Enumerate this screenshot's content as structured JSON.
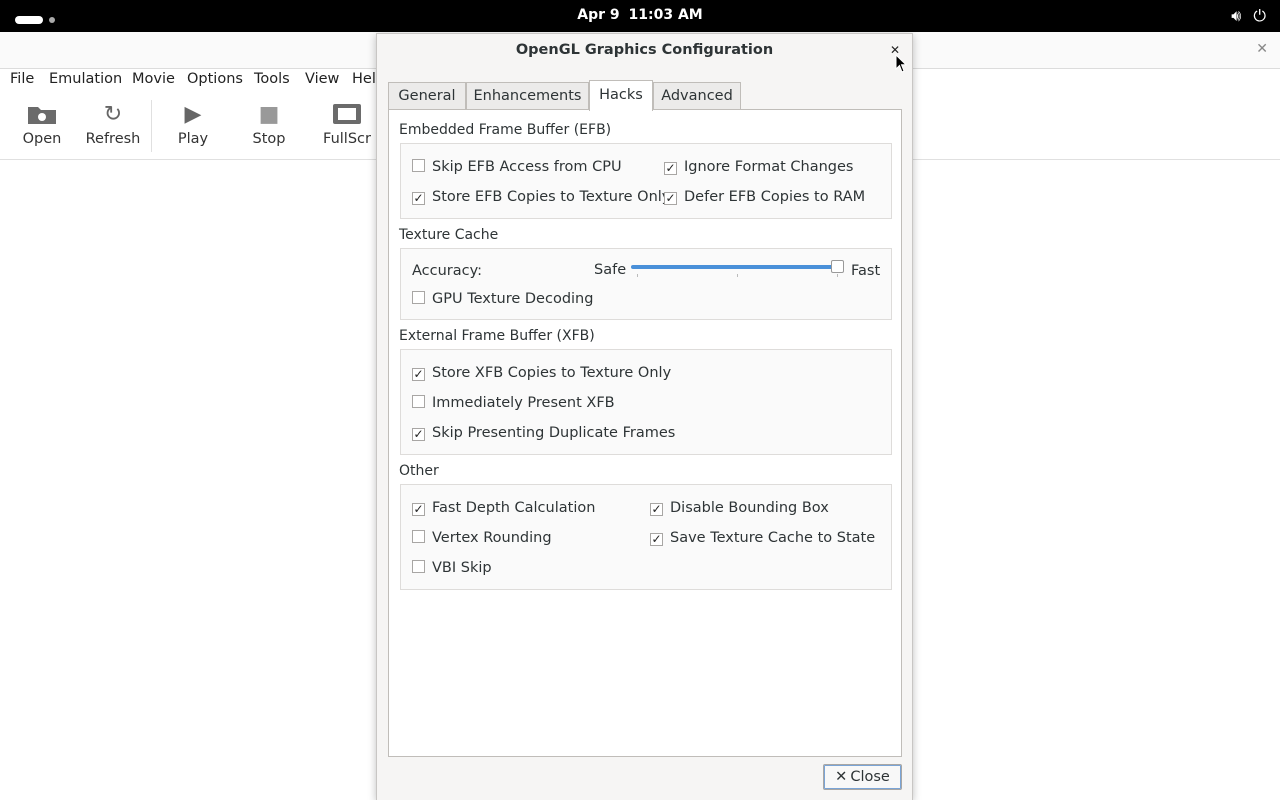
{
  "topbar": {
    "date": "Apr 9",
    "time": "11:03 AM",
    "volume_icon": "volume-icon",
    "power_icon": "power-icon"
  },
  "bg_app": {
    "menu": [
      "File",
      "Emulation",
      "Movie",
      "Options",
      "Tools",
      "View",
      "Hel"
    ],
    "toolbar": {
      "open": "Open",
      "refresh": "Refresh",
      "play": "Play",
      "stop": "Stop",
      "fullscreen": "FullScr"
    }
  },
  "dialog": {
    "title": "OpenGL Graphics Configuration",
    "tabs": [
      "General",
      "Enhancements",
      "Hacks",
      "Advanced"
    ],
    "active_tab": "Hacks",
    "efb": {
      "title": "Embedded Frame Buffer (EFB)",
      "skip_access": {
        "label": "Skip EFB Access from CPU",
        "checked": false
      },
      "ignore_format": {
        "label": "Ignore Format Changes",
        "checked": true
      },
      "store_copies": {
        "label": "Store EFB Copies to Texture Only",
        "checked": true
      },
      "defer_copies": {
        "label": "Defer EFB Copies to RAM",
        "checked": true
      }
    },
    "texture_cache": {
      "title": "Texture Cache",
      "accuracy_label": "Accuracy:",
      "safe_label": "Safe",
      "fast_label": "Fast",
      "accuracy_value": 1.0,
      "gpu_decoding": {
        "label": "GPU Texture Decoding",
        "checked": false
      }
    },
    "xfb": {
      "title": "External Frame Buffer (XFB)",
      "store_copies": {
        "label": "Store XFB Copies to Texture Only",
        "checked": true
      },
      "immediately_present": {
        "label": "Immediately Present XFB",
        "checked": false
      },
      "skip_duplicates": {
        "label": "Skip Presenting Duplicate Frames",
        "checked": true
      }
    },
    "other": {
      "title": "Other",
      "fast_depth": {
        "label": "Fast Depth Calculation",
        "checked": true
      },
      "disable_bbox": {
        "label": "Disable Bounding Box",
        "checked": true
      },
      "vertex_rounding": {
        "label": "Vertex Rounding",
        "checked": false
      },
      "save_texture_cache": {
        "label": "Save Texture Cache to State",
        "checked": true
      },
      "vbi_skip": {
        "label": "VBI Skip",
        "checked": false
      }
    },
    "close_button": "Close"
  }
}
